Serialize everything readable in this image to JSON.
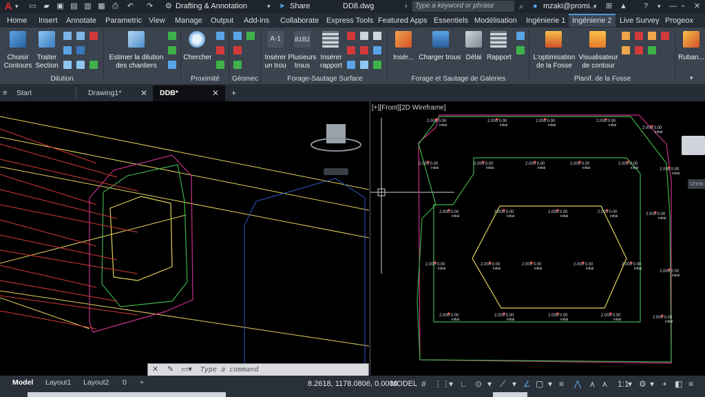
{
  "titlebar": {
    "workspace": "Drafting & Annotation",
    "share": "Share",
    "document": "DD8.dwg",
    "search_placeholder": "Type a keyword or phrase",
    "user": "mzaki@promi..."
  },
  "ribbon_tabs": [
    "Home",
    "Insert",
    "Annotate",
    "Parametric",
    "View",
    "Manage",
    "Output",
    "Add-ins",
    "Collaborate",
    "Express Tools",
    "Featured Apps",
    "Essentiels",
    "Modélisation",
    "Ingénierie 1",
    "Ingénierie 2",
    "Live Survey",
    "Progeox"
  ],
  "active_tab": "Ingénierie 2",
  "ribbon": {
    "choisir": "Choisir\nContours",
    "traiter": "Traiter\nSection",
    "panel_dilution": "Dilution",
    "estimer": "Estimer la dilution\ndes chantiers",
    "chercher": "Chercher",
    "panel_proximite": "Proximité",
    "panel_geomec": "Géomec",
    "inserer_trou": "Insérer\nun trou",
    "plusieurs_trous": "Plusieurs\ntrous",
    "inserer_rapport": "Insérer\nrapport",
    "panel_forage_surface": "Forage-Sautage Surface",
    "inserer": "Insér...",
    "charger_trous": "Charger trous",
    "delai": "Délai",
    "rapport": "Rapport",
    "panel_galeries": "Forage et Sautage de Galeries",
    "optimisation": "L'optimisation\nde la Fosse",
    "visualisateur": "Visualisateur\nde contour",
    "panel_fosse": "Planif. de la Fosse",
    "ruban": "Ruban..."
  },
  "doc_tabs": [
    "Start",
    "Drawing1*",
    "DDB*"
  ],
  "viewport_label": "[+][Front][2D Wireframe]",
  "command_placeholder": "Type a command",
  "layout_tabs": [
    "Model",
    "Layout1",
    "Layout2",
    "0"
  ],
  "status": {
    "coordinates": "8.2618, 1178.0806, 0.0000",
    "model": "MODEL",
    "scale": "1:1"
  },
  "colors": {
    "magenta": "#c8328c",
    "green": "#3fb24a",
    "yellow": "#e4d35a",
    "blue": "#2f58c8",
    "red": "#d83a3a",
    "accent": "#4f9ad8"
  },
  "hole_labels": {
    "depth": "2.000",
    "top": "0.00",
    "type": "initial"
  }
}
